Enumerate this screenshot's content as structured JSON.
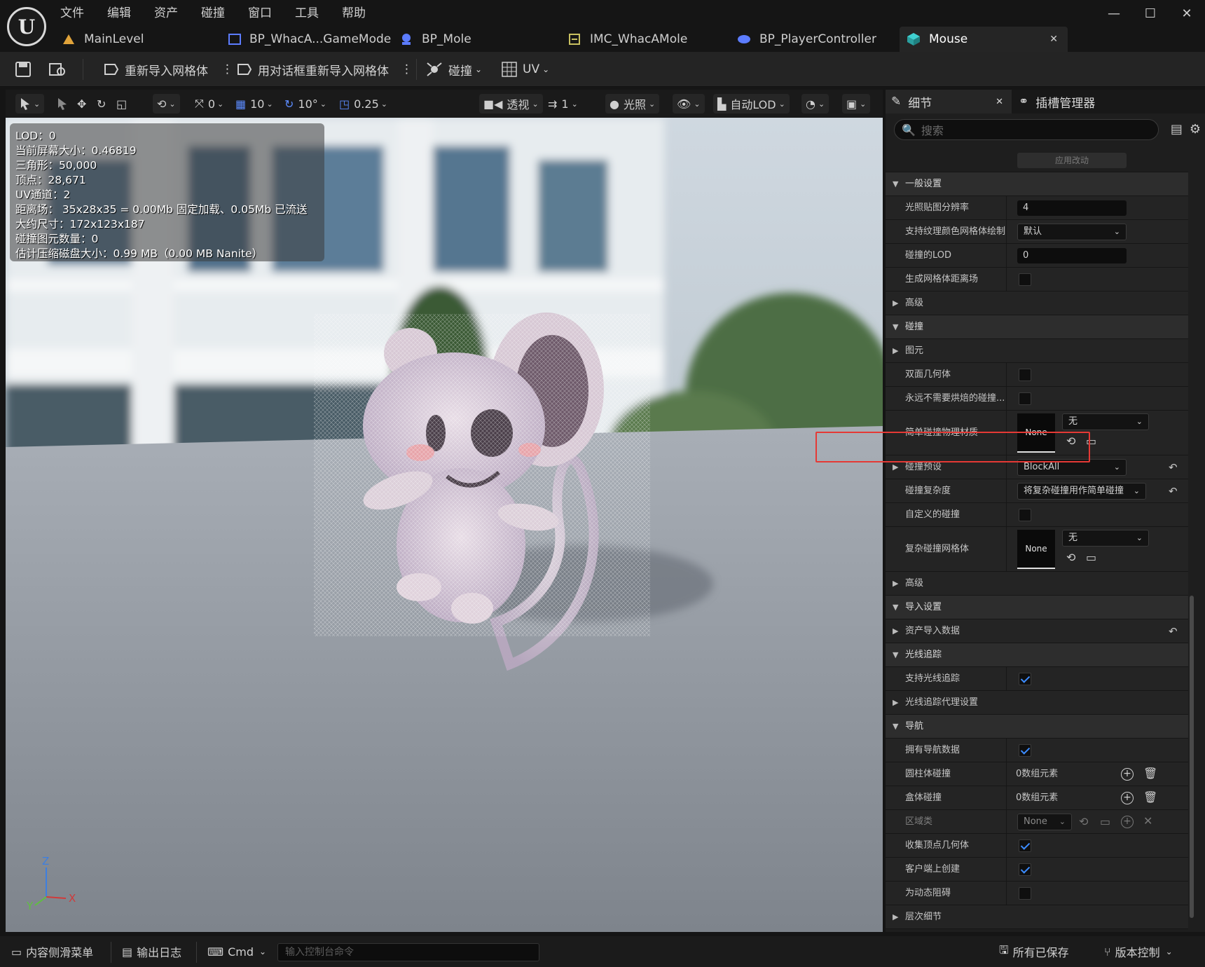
{
  "menu": [
    "文件",
    "编辑",
    "资产",
    "碰撞",
    "窗口",
    "工具",
    "帮助"
  ],
  "tabs": [
    {
      "label": "MainLevel",
      "icon": "level-icon"
    },
    {
      "label": "BP_WhacA...GameMode",
      "icon": "blueprint-icon"
    },
    {
      "label": "BP_Mole",
      "icon": "pawn-icon"
    },
    {
      "label": "IMC_WhacAMole",
      "icon": "input-mapping-icon"
    },
    {
      "label": "BP_PlayerController",
      "icon": "controller-icon"
    },
    {
      "label": "Mouse",
      "icon": "static-mesh-icon"
    }
  ],
  "toolbar": {
    "reimport": "重新导入网格体",
    "reimport_dialog": "用对话框重新导入网格体",
    "collision": "碰撞",
    "uv": "UV"
  },
  "viewport_bar": {
    "rot_snap": "0",
    "grid_snap": "10",
    "angle_snap": "10°",
    "scale_snap": "0.25",
    "view_mode": "透视",
    "camera_speed": "1",
    "lighting": "光照",
    "lod": "自动LOD"
  },
  "stats": [
    "LOD：0",
    "当前屏幕大小：0.46819",
    "三角形：50,000",
    "顶点：28,671",
    "UV通道：2",
    "距离场： 35x28x35 = 0.00Mb 固定加载、0.05Mb 已流送",
    "大约尺寸：172x123x187",
    "碰撞图元数量：0",
    "估计压缩磁盘大小：0.99 MB（0.00 MB Nanite）"
  ],
  "axis": {
    "z": "Z",
    "x": "X",
    "y": "Y"
  },
  "details": {
    "tab": "细节",
    "tab2": "插槽管理器",
    "search_placeholder": "搜索",
    "apply": "应用改动",
    "rows": {
      "general": "一般设置",
      "lightmap_res": "光照贴图分辨率",
      "lightmap_res_val": "4",
      "vertex_paint": "支持纹理颜色网格体绘制",
      "vertex_paint_val": "默认",
      "lod_for_collision": "碰撞的LOD",
      "lod_for_collision_val": "0",
      "gen_distfield": "生成网格体距离场",
      "advanced1": "高级",
      "collision": "碰撞",
      "primitives": "图元",
      "double_sided": "双面几何体",
      "never_bake": "永远不需要烘焙的碰撞...",
      "simple_phys_mat": "简单碰撞物理材质",
      "none": "None",
      "none_cn": "无",
      "collision_preset": "碰撞预设",
      "collision_preset_val": "BlockAll",
      "collision_complexity": "碰撞复杂度",
      "collision_complexity_val": "将复杂碰撞用作简单碰撞",
      "custom_collision": "自定义的碰撞",
      "complex_collision_mesh": "复杂碰撞网格体",
      "advanced2": "高级",
      "import_settings": "导入设置",
      "asset_import_data": "资产导入数据",
      "raytracing": "光线追踪",
      "support_raytracing": "支持光线追踪",
      "raytracing_proxy": "光线追踪代理设置",
      "navigation": "导航",
      "has_nav_data": "拥有导航数据",
      "cylinder_collision": "圆柱体碰撞",
      "array_elements": "0数组元素",
      "box_collision": "盒体碰撞",
      "area_class": "区域类",
      "area_class_val": "None",
      "gather_convex": "收集顶点几何体",
      "create_on_client": "客户端上创建",
      "dynamic_obstacle": "为动态阻碍",
      "lod_details": "层次细节"
    }
  },
  "statusbar": {
    "content_drawer": "内容侧滑菜单",
    "output_log": "输出日志",
    "cmd": "Cmd",
    "console_placeholder": "输入控制台命令",
    "all_saved": "所有已保存",
    "source_control": "版本控制"
  },
  "colors": {
    "accent": "#3c8cff",
    "highlight": "#e53935",
    "panel": "#242424"
  }
}
